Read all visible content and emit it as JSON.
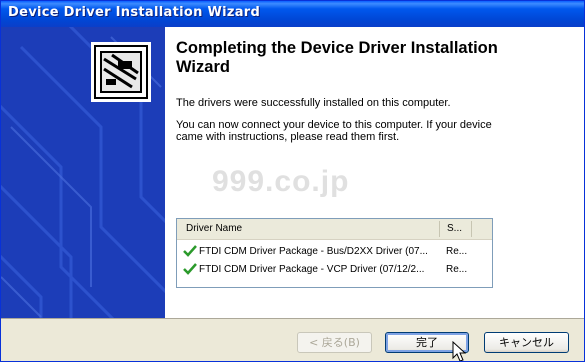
{
  "window": {
    "title": "Device Driver Installation Wizard"
  },
  "content": {
    "heading": "Completing the Device Driver Installation Wizard",
    "line1": "The drivers were successfully installed on this computer.",
    "line2a": "You can now connect your device to this computer. If your device",
    "line2b": "came with instructions, please read them first.",
    "watermark": "999.co.jp"
  },
  "driver_list": {
    "columns": [
      "Driver Name",
      "S..."
    ],
    "rows": [
      {
        "name": "FTDI CDM Driver Package - Bus/D2XX Driver (07...",
        "status": "Re..."
      },
      {
        "name": "FTDI CDM Driver Package - VCP Driver (07/12/2...",
        "status": "Re..."
      }
    ]
  },
  "buttons": {
    "back": "< 戻る(B)",
    "finish": "完了",
    "cancel": "キャンセル"
  },
  "icons": {
    "sidebar": "hardware-device-icon",
    "check": "green-check-icon",
    "cursor": "mouse-pointer-icon"
  },
  "colors": {
    "titlebar": "#0054e3",
    "sidebar": "#1c3db8",
    "check": "#2b9a2b"
  }
}
